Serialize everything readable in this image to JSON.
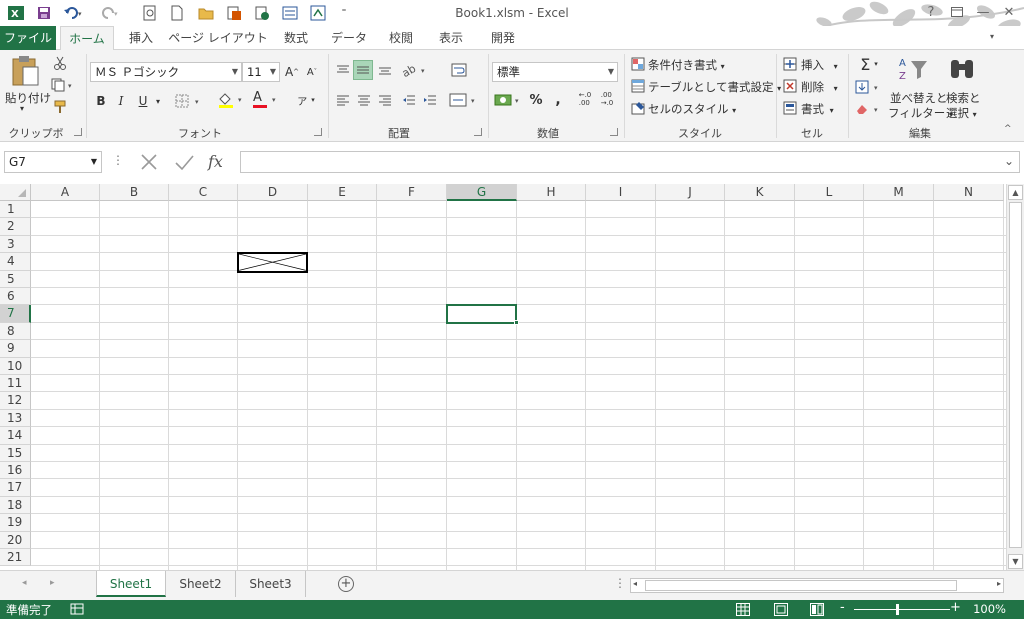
{
  "window": {
    "title": "Book1.xlsm - Excel"
  },
  "ribbon_tabs": [
    "ファイル",
    "ホーム",
    "挿入",
    "ページ レイアウト",
    "数式",
    "データ",
    "校閲",
    "表示",
    "開発"
  ],
  "clipboard": {
    "paste_label": "貼り付け",
    "group_label": "クリップボード"
  },
  "font": {
    "name": "ＭＳ Ｐゴシック",
    "size": "11",
    "bold": "B",
    "italic": "I",
    "underline": "U",
    "font_color_glyph": "A",
    "phonetic_glyph": "ア",
    "grow_glyph": "A",
    "shrink_glyph": "A",
    "group_label": "フォント"
  },
  "alignment": {
    "group_label": "配置"
  },
  "number": {
    "format": "標準",
    "percent": "%",
    "comma": ",",
    "inc_decimal": "←.0\n.00",
    "dec_decimal": ".00\n→.0",
    "group_label": "数値"
  },
  "styles": {
    "conditional": "条件付き書式",
    "as_table": "テーブルとして書式設定",
    "cell_styles": "セルのスタイル",
    "group_label": "スタイル"
  },
  "cells": {
    "insert": "挿入",
    "delete": "削除",
    "format": "書式",
    "group_label": "セル"
  },
  "editing": {
    "sort_filter_1": "並べ替えと",
    "sort_filter_2": "フィルター",
    "find_select_1": "検索と",
    "find_select_2": "選択",
    "group_label": "編集",
    "sigma": "Σ"
  },
  "formula_bar": {
    "name_box": "G7",
    "formula": "",
    "fx": "fx"
  },
  "columns": [
    "A",
    "B",
    "C",
    "D",
    "E",
    "F",
    "G",
    "H",
    "I",
    "J",
    "K",
    "L",
    "M",
    "N"
  ],
  "rows": [
    "1",
    "2",
    "3",
    "4",
    "5",
    "6",
    "7",
    "8",
    "9",
    "10",
    "11",
    "12",
    "13",
    "14",
    "15",
    "16",
    "17",
    "18",
    "19",
    "20",
    "21"
  ],
  "selected_cell": {
    "column": "G",
    "row": "7"
  },
  "sheets": [
    {
      "name": "Sheet1",
      "active": true
    },
    {
      "name": "Sheet2",
      "active": false
    },
    {
      "name": "Sheet3",
      "active": false
    }
  ],
  "statusbar": {
    "ready": "準備完了",
    "zoom": "100%"
  },
  "colors": {
    "accent": "#217346",
    "ribbon_bg": "#f3f3f3",
    "font_red": "#e81123",
    "highlight_yellow": "#ffff00"
  },
  "icons": [
    "excel-icon",
    "save-icon",
    "undo-icon",
    "redo-icon",
    "print-preview-icon",
    "new-icon",
    "open-icon",
    "paste-icon",
    "cut-icon",
    "copy-icon",
    "format-painter-icon",
    "border-icon",
    "fill-color-icon",
    "font-color-icon",
    "sum-icon",
    "fill-icon",
    "clear-icon",
    "sort-filter-icon",
    "find-icon",
    "user-avatar-icon"
  ]
}
